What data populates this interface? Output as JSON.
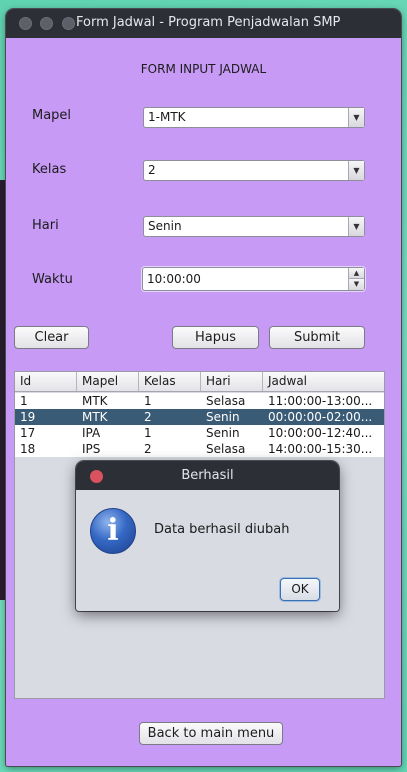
{
  "window": {
    "title": "Form Jadwal - Program Penjadwalan SMP"
  },
  "form": {
    "header": "FORM INPUT JADWAL",
    "mapel_label": "Mapel",
    "mapel_value": "1-MTK",
    "kelas_label": "Kelas",
    "kelas_value": "2",
    "hari_label": "Hari",
    "hari_value": "Senin",
    "waktu_label": "Waktu",
    "waktu_value": "10:00:00"
  },
  "buttons": {
    "clear": "Clear",
    "hapus": "Hapus",
    "submit": "Submit",
    "back": "Back to main menu"
  },
  "table": {
    "columns": [
      "Id",
      "Mapel",
      "Kelas",
      "Hari",
      "Jadwal"
    ],
    "rows": [
      [
        "1",
        "MTK",
        "1",
        "Selasa",
        "11:00:00-13:00..."
      ],
      [
        "19",
        "MTK",
        "2",
        "Senin",
        "00:00:00-02:00..."
      ],
      [
        "17",
        "IPA",
        "1",
        "Senin",
        "10:00:00-12:40..."
      ],
      [
        "18",
        "IPS",
        "2",
        "Selasa",
        "14:00:00-15:30..."
      ]
    ],
    "selected_row": 1
  },
  "dialog": {
    "title": "Berhasil",
    "message": "Data berhasil diubah",
    "ok_label": "OK",
    "icon": "info-icon"
  },
  "colors": {
    "window_bg": "#c79af5",
    "titlebar": "#2d2f37",
    "selected_row": "#395b76",
    "desktop": "#6ed9b9"
  }
}
